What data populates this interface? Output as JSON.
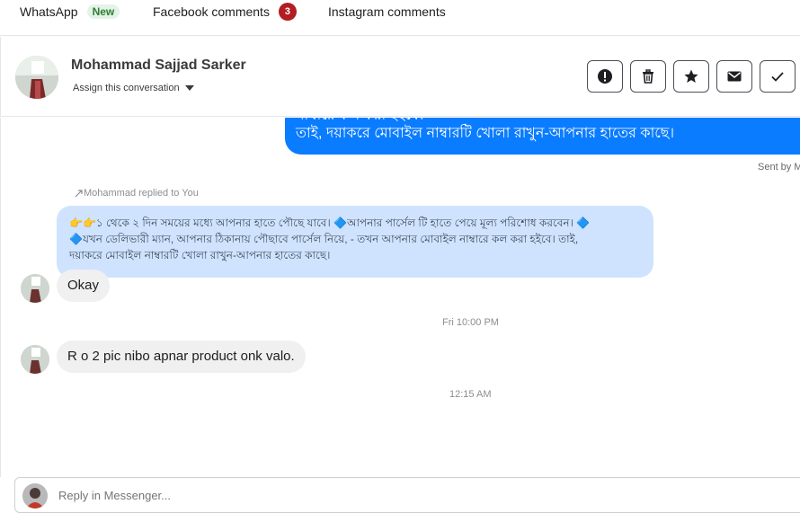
{
  "tabs": [
    {
      "label": "WhatsApp",
      "badge": "New"
    },
    {
      "label": "Facebook comments",
      "badge": "3"
    },
    {
      "label": "Instagram comments"
    }
  ],
  "header": {
    "name": "Mohammad Sajjad Sarker",
    "assign_label": "Assign this conversation",
    "actions": [
      "report-icon",
      "delete-icon",
      "star-icon",
      "mail-icon",
      "check-icon"
    ]
  },
  "thread": {
    "outgoing": {
      "line1": "নাম্বারে কল করা হইবে।",
      "line2": "তাই, দয়াকরে মোবাইল নাম্বারটি খোলা রাখুন-আপনার হাতের কাছে।",
      "sent_by": "Sent by M"
    },
    "reply_note": "Mohammad replied to You",
    "quoted": {
      "line1": "👉👉১ থেকে ২ দিন সময়ের মধ্যে আপনার হাতে পৌছে যাবে। 🔷আপনার পার্সেল টি হাতে পেয়ে মূল্য পরিশোধ করবেন। 🔷",
      "line2": "🔷যখন ডেলিভারী ম্যান, আপনার ঠিকানায় পৌছাবে পার্সেল নিয়ে, - তখন আপনার মোবাইল নাম্বারে কল করা হইবে। তাই,",
      "line3": "দয়াকরে মোবাইল নাম্বারটি খোলা রাখুন-আপনার হাতের কাছে।"
    },
    "msg1": "Okay",
    "time1": "Fri 10:00 PM",
    "msg2": "R o 2 pic nibo apnar product onk valo.",
    "time2": "12:15 AM"
  },
  "composer": {
    "placeholder": "Reply in Messenger..."
  }
}
